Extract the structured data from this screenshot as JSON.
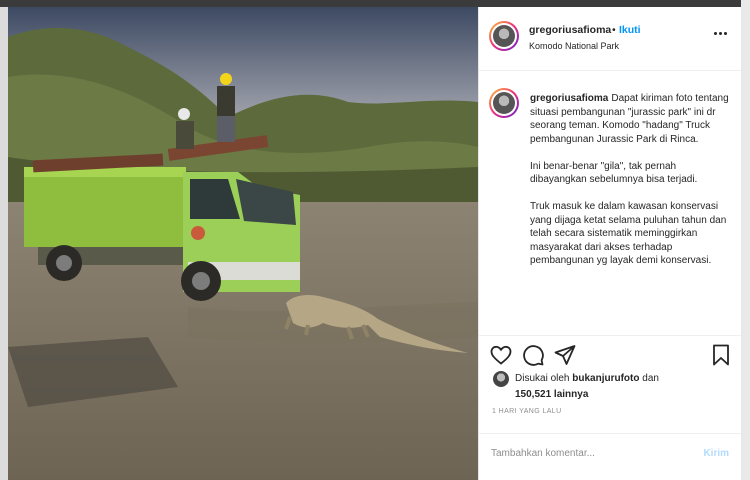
{
  "post": {
    "username": "gregoriusafioma",
    "follow_separator": "•",
    "follow_label": "Ikuti",
    "location": "Komodo National Park",
    "caption_username": "gregoriusafioma",
    "caption_paragraphs": [
      "Dapat kiriman foto tentang situasi pembangunan \"jurassic park\" ini dr seorang teman. Komodo \"hadang\" Truck pembangunan Jurassic Park di Rinca.",
      "Ini benar-benar \"gila\", tak pernah dibayangkan sebelumnya bisa terjadi.",
      "Truk masuk ke dalam kawasan konservasi yang dijaga ketat selama puluhan tahun dan telah secara sistematik meminggirkan masyarakat dari akses terhadap pembangunan yg layak demi konservasi."
    ],
    "likes": {
      "prefix": "Disukai oleh",
      "liker": "bukanjurufoto",
      "joiner": "dan",
      "count_others": "150,521 lainnya"
    },
    "timestamp": "1 HARI YANG LALU",
    "comment_placeholder": "Tambahkan komentar...",
    "post_button": "Kirim"
  },
  "icons": {
    "more": "more-options-icon",
    "like": "heart-icon",
    "comment": "comment-icon",
    "share": "share-icon",
    "save": "bookmark-icon"
  },
  "colors": {
    "follow": "#0095f6",
    "post_button_disabled": "#b3dbff",
    "text": "#262626",
    "muted": "#8e8e8e"
  }
}
